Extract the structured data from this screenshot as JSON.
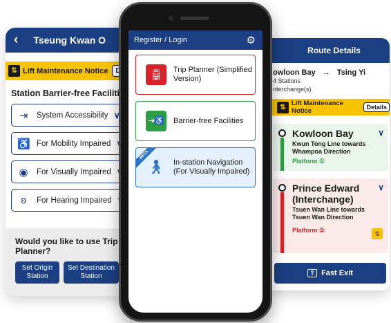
{
  "left_screen": {
    "title": "Tseung Kwan O",
    "back_icon": "‹",
    "notice": {
      "text": "Lift Maintenance Notice",
      "details": "Detai"
    },
    "section_heading": "Station Barrier-free Facilities",
    "facilities": [
      {
        "label": "System Accessibility",
        "icon": "door-icon"
      },
      {
        "label": "For Mobility Impaired",
        "icon": "wheelchair-icon"
      },
      {
        "label": "For Visually Impaired",
        "icon": "eye-icon"
      },
      {
        "label": "For Hearing Impaired",
        "icon": "ear-icon"
      }
    ],
    "bottom": {
      "question": "Would you like to use Trip Planner?",
      "set_origin": "Set Origin Station",
      "set_destination": "Set Destination Station"
    }
  },
  "center_screen": {
    "header": "Register / Login",
    "tiles": [
      {
        "label": "Trip Planner (Simplified Version)",
        "icon": "train-icon"
      },
      {
        "label": "Barrier-free Facilities",
        "icon": "accessibility-icon"
      },
      {
        "label": "In-station Navigation (For Visually Impaired)",
        "icon": "visually-impaired-icon",
        "badge": "BETA"
      }
    ]
  },
  "right_screen": {
    "title": "Route Details",
    "from": "owloon Bay",
    "arrow": "→",
    "to": "Tsing Yi",
    "stations": "4 Stations",
    "interchange": "nterchange(s)",
    "notice": {
      "text": "Lift Maintenance Notice",
      "details": "Details"
    },
    "stops": [
      {
        "name": "Kowloon Bay",
        "line": "Kwun Tong Line towards Whampoa Direction",
        "platform": "Platform ①",
        "color": "#2e9e44"
      },
      {
        "name": "Prince Edward (Interchange)",
        "line": "Tsuen Wan Line towards Tsuen Wan Direction",
        "platform": "Platform ①",
        "color": "#d92328"
      }
    ],
    "fast_exit": "Fast Exit"
  },
  "colors": {
    "navy": "#1b3f82",
    "notice_yellow": "#f7c300",
    "green": "#2e9e44",
    "red": "#d92328",
    "blue": "#2d73c9"
  }
}
